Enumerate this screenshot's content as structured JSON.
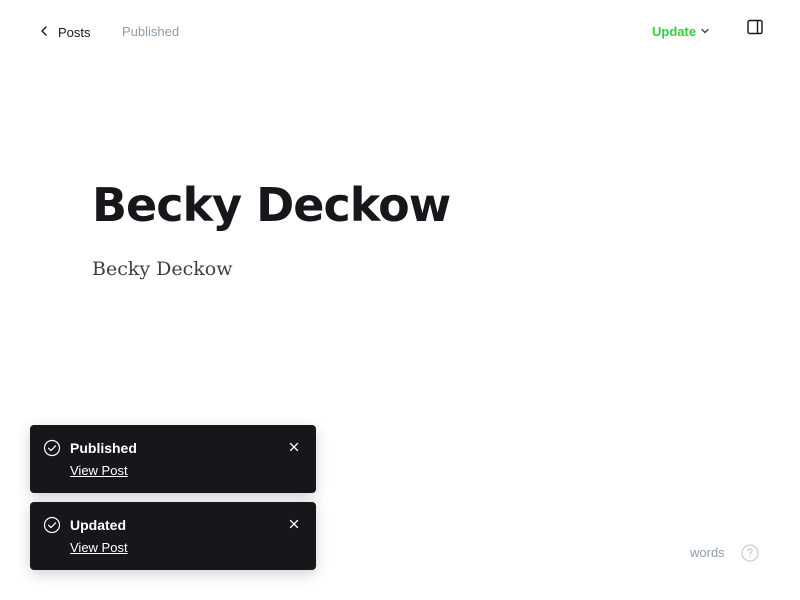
{
  "header": {
    "back_label": "Posts",
    "status": "Published",
    "update_label": "Update"
  },
  "editor": {
    "title": "Becky Deckow",
    "body": "Becky Deckow"
  },
  "toasts": [
    {
      "title": "Published",
      "link": "View Post"
    },
    {
      "title": "Updated",
      "link": "View Post"
    }
  ],
  "footer": {
    "word_count_label": "words"
  },
  "colors": {
    "accent_green": "#30cf43",
    "toast_bg": "#15171a",
    "muted_text": "#8e9cac"
  },
  "icons": [
    "chevron-left-icon",
    "chevron-down-icon",
    "sidebar-panel-icon",
    "check-circle-icon",
    "close-icon",
    "help-circle-icon"
  ]
}
